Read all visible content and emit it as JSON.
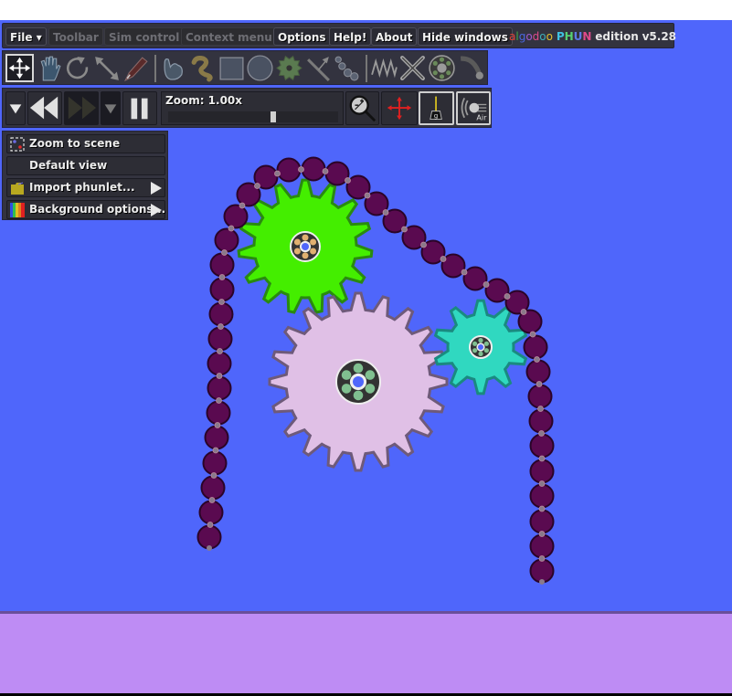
{
  "app": {
    "title": "Algodoo Phun edition",
    "brand": {
      "algo_letters": [
        {
          "ch": "a",
          "color": "#e0443a"
        },
        {
          "ch": "l",
          "color": "#3fa845"
        },
        {
          "ch": "g",
          "color": "#4a66e0"
        },
        {
          "ch": "o",
          "color": "#a05ad0"
        },
        {
          "ch": "d",
          "color": "#e04a8a"
        },
        {
          "ch": "o",
          "color": "#3fb0b8"
        },
        {
          "ch": "o",
          "color": "#e0c030"
        }
      ],
      "phun_letters": [
        {
          "ch": "P",
          "color": "#3fc0e0"
        },
        {
          "ch": "H",
          "color": "#57d070"
        },
        {
          "ch": "U",
          "color": "#5c7ae8"
        },
        {
          "ch": "N",
          "color": "#e04a8a"
        }
      ],
      "edition": "edition",
      "version": "v5.28"
    }
  },
  "menubar": {
    "items": [
      {
        "label": "File ▾",
        "enabled": true
      },
      {
        "label": "Toolbar",
        "enabled": false
      },
      {
        "label": "Sim control",
        "enabled": false
      },
      {
        "label": "Context menu",
        "enabled": false
      },
      {
        "label": "Options",
        "enabled": true
      },
      {
        "label": "Help!",
        "enabled": true
      },
      {
        "label": "About",
        "enabled": true
      },
      {
        "label": "Hide windows",
        "enabled": true
      }
    ]
  },
  "toolbar": {
    "tools": [
      {
        "name": "move-tool",
        "selected": true
      },
      {
        "name": "drag-tool",
        "selected": false
      },
      {
        "name": "rotate-tool",
        "selected": false
      },
      {
        "name": "scale-tool",
        "selected": false
      },
      {
        "name": "knife-tool",
        "selected": false
      },
      {
        "name": "sketch-tool",
        "selected": false
      },
      {
        "name": "brush-tool",
        "selected": false
      },
      {
        "name": "box-tool",
        "selected": false
      },
      {
        "name": "circle-tool",
        "selected": false
      },
      {
        "name": "gear-tool",
        "selected": false
      },
      {
        "name": "plane-tool",
        "selected": false
      },
      {
        "name": "chain-tool",
        "selected": false
      },
      {
        "name": "spring-tool",
        "selected": false
      },
      {
        "name": "fixate-tool",
        "selected": false
      },
      {
        "name": "hinge-tool",
        "selected": false
      },
      {
        "name": "tracer-tool",
        "selected": false
      }
    ]
  },
  "simcontrol": {
    "zoom_label": "Zoom: 1.00x",
    "zoom_slider_fraction": 0.62,
    "gravity_on": true,
    "air_on": true,
    "air_label": "Air",
    "gravity_label": "g"
  },
  "context_menu": {
    "items": [
      {
        "label": "Zoom to scene",
        "icon": "zoom-scene-icon",
        "submenu": false
      },
      {
        "label": "Default view",
        "icon": "",
        "submenu": false
      },
      {
        "label": "Import phunlet...",
        "icon": "folder-icon",
        "submenu": true
      },
      {
        "label": "Background options...",
        "icon": "color-bars-icon",
        "submenu": true
      }
    ]
  },
  "scene": {
    "background_color": "#4f66fb",
    "ground_color": "#be8cf4",
    "gears": [
      {
        "name": "green-gear",
        "fill": "#44ee00",
        "stroke": "#2a8a10",
        "teeth": 15,
        "hub_ball_color": "#e0b070"
      },
      {
        "name": "pink-gear",
        "fill": "#e0c0e6",
        "stroke": "#6e5a7a",
        "teeth": 20,
        "hub_ball_color": "#80c090"
      },
      {
        "name": "teal-gear",
        "fill": "#30d8c0",
        "stroke": "#1a8a80",
        "teeth": 10,
        "hub_ball_color": "#80c090"
      }
    ],
    "chain": {
      "bead_color": "#5a0a50",
      "bead_count": 39
    }
  }
}
